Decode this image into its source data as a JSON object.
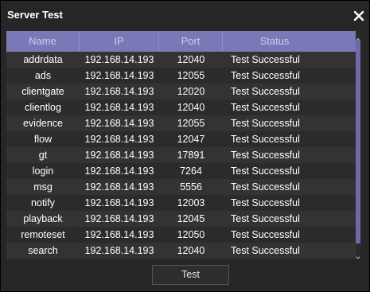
{
  "window": {
    "title": "Server Test"
  },
  "grid": {
    "columns": [
      "Name",
      "IP",
      "Port",
      "Status"
    ],
    "rows": [
      {
        "name": "addrdata",
        "ip": "192.168.14.193",
        "port": "12040",
        "status": "Test Successful"
      },
      {
        "name": "ads",
        "ip": "192.168.14.193",
        "port": "12055",
        "status": "Test Successful"
      },
      {
        "name": "clientgate",
        "ip": "192.168.14.193",
        "port": "12020",
        "status": "Test Successful"
      },
      {
        "name": "clientlog",
        "ip": "192.168.14.193",
        "port": "12040",
        "status": "Test Successful"
      },
      {
        "name": "evidence",
        "ip": "192.168.14.193",
        "port": "12055",
        "status": "Test Successful"
      },
      {
        "name": "flow",
        "ip": "192.168.14.193",
        "port": "12047",
        "status": "Test Successful"
      },
      {
        "name": "gt",
        "ip": "192.168.14.193",
        "port": "17891",
        "status": "Test Successful"
      },
      {
        "name": "login",
        "ip": "192.168.14.193",
        "port": "7264",
        "status": "Test Successful"
      },
      {
        "name": "msg",
        "ip": "192.168.14.193",
        "port": "5556",
        "status": "Test Successful"
      },
      {
        "name": "notify",
        "ip": "192.168.14.193",
        "port": "12003",
        "status": "Test Successful"
      },
      {
        "name": "playback",
        "ip": "192.168.14.193",
        "port": "12045",
        "status": "Test Successful"
      },
      {
        "name": "remoteset",
        "ip": "192.168.14.193",
        "port": "12050",
        "status": "Test Successful"
      },
      {
        "name": "search",
        "ip": "192.168.14.193",
        "port": "12040",
        "status": "Test Successful"
      }
    ]
  },
  "footer": {
    "test_label": "Test"
  },
  "icons": {
    "close": "close-icon",
    "scroll_up": "chevron-up-icon",
    "scroll_down": "chevron-down-icon"
  },
  "colors": {
    "window_bg": "#262626",
    "panel_bg": "#333333",
    "header_bg": "#7b78b8",
    "header_text": "#cfcde8",
    "row_alt": "#2b2b2b",
    "scroll_thumb": "#6e6aa8",
    "text": "#ffffff"
  }
}
